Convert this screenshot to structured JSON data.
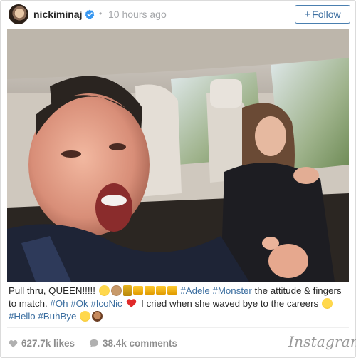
{
  "post": {
    "username": "nickiminaj",
    "separator": "•",
    "time_ago": "10 hours ago",
    "follow_label": "Follow",
    "follow_plus": "+"
  },
  "caption": {
    "line1_text": "Pull thru, QUEEN!!!!! ",
    "tag_adele": "#Adele",
    "tag_monster": "#Monster",
    "text_attitude": " the attitude & fingers to match. ",
    "tag_oh": "#Oh",
    "tag_ok": "#Ok",
    "tag_iconic": "#IcoNic",
    "text_cried": " I cried when she waved bye to the careers ",
    "tag_hello": "#Hello",
    "tag_buhbye": "#BuhBye"
  },
  "stats": {
    "likes": "627.7k likes",
    "comments": "38.4k comments"
  },
  "brand": "Instagram",
  "colors": {
    "link": "#3b6ea0",
    "follow_border": "#4a7fb0",
    "muted": "#8e8e8e",
    "verified": "#3897f0",
    "heart_red": "#e02a2a"
  },
  "icons": [
    "verified-badge-icon",
    "heart-icon",
    "comment-bubble-icon",
    "red-heart-emoji"
  ]
}
